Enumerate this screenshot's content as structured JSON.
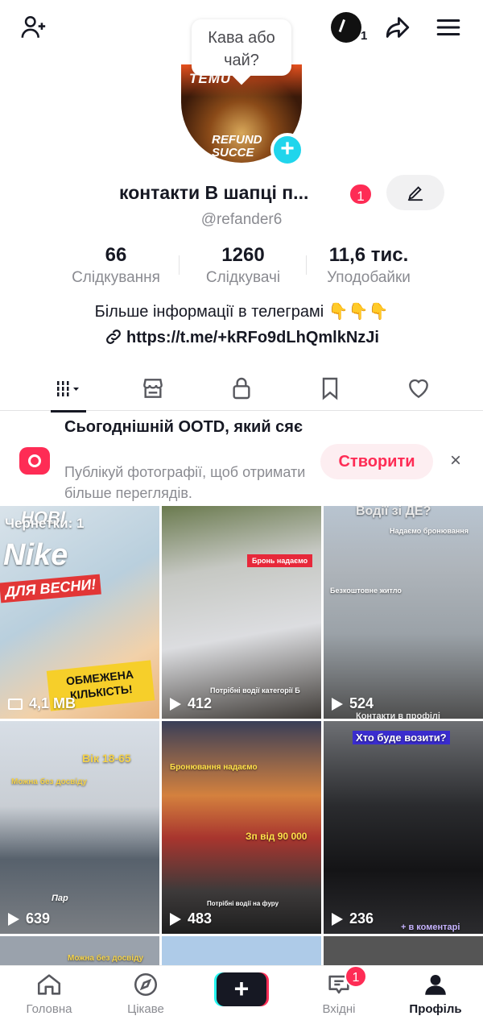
{
  "topbar": {
    "following_count_badge": "1",
    "status_bubble": "Кава або чай?"
  },
  "avatar": {
    "text_top": "TEMU",
    "text_bottom": "REFUND SUCCE"
  },
  "profile": {
    "name": "контакти  В шапці п...",
    "name_badge": "1",
    "handle": "@refander6"
  },
  "stats": [
    {
      "value": "66",
      "label": "Слідкування"
    },
    {
      "value": "1260",
      "label": "Слідкувачі"
    },
    {
      "value": "11,6 тис.",
      "label": "Уподобайки"
    }
  ],
  "bio": {
    "text": "Більше інформації в телеграмі",
    "emoji": "👇👇👇",
    "link": "https://t.me/+kRFo9dLhQmlkNzJi"
  },
  "tabs": [
    "videos-grid",
    "shop",
    "private",
    "saved",
    "liked"
  ],
  "promo": {
    "title": "Сьогоднішній OOTD, який сяє",
    "subtitle": "Публікуй фотографії, щоб отримати більше переглядів.",
    "button": "Створити",
    "close": "×"
  },
  "videos": [
    {
      "overlay": "Чернетки: 1",
      "size": "4,1 MB",
      "big_text": "Nike",
      "extra1": "ДЛЯ ВЕСНИ!",
      "extra2": "ОБМЕЖЕНА КІЛЬКІСТЬ!",
      "top": "НОВІ"
    },
    {
      "overlay": "Бронь надаємо",
      "views": "412",
      "caption": "Потрібні водії категорії Б"
    },
    {
      "overlay": "Водії зі ДЕ?",
      "views": "524",
      "caption": "Безкоштовне житло",
      "top2": "Надаємо бронювання",
      "bottom": "Контакти в профілі"
    },
    {
      "overlay": "Вік 18-65",
      "views": "639",
      "caption": "Можна без досвіду",
      "top": "Пар"
    },
    {
      "overlay": "Бронювання надаємо",
      "views": "483",
      "caption": "Зп від 90 000",
      "bottom": "Потрібні водії на фуру"
    },
    {
      "overlay": "Хто буде возити?",
      "views": "236",
      "caption": "+ в коментарі"
    },
    {
      "overlay": "Можна без досвіду"
    }
  ],
  "bottom_nav": {
    "home": "Головна",
    "discover": "Цікаве",
    "inbox": "Вхідні",
    "inbox_badge": "1",
    "profile": "Профіль"
  }
}
